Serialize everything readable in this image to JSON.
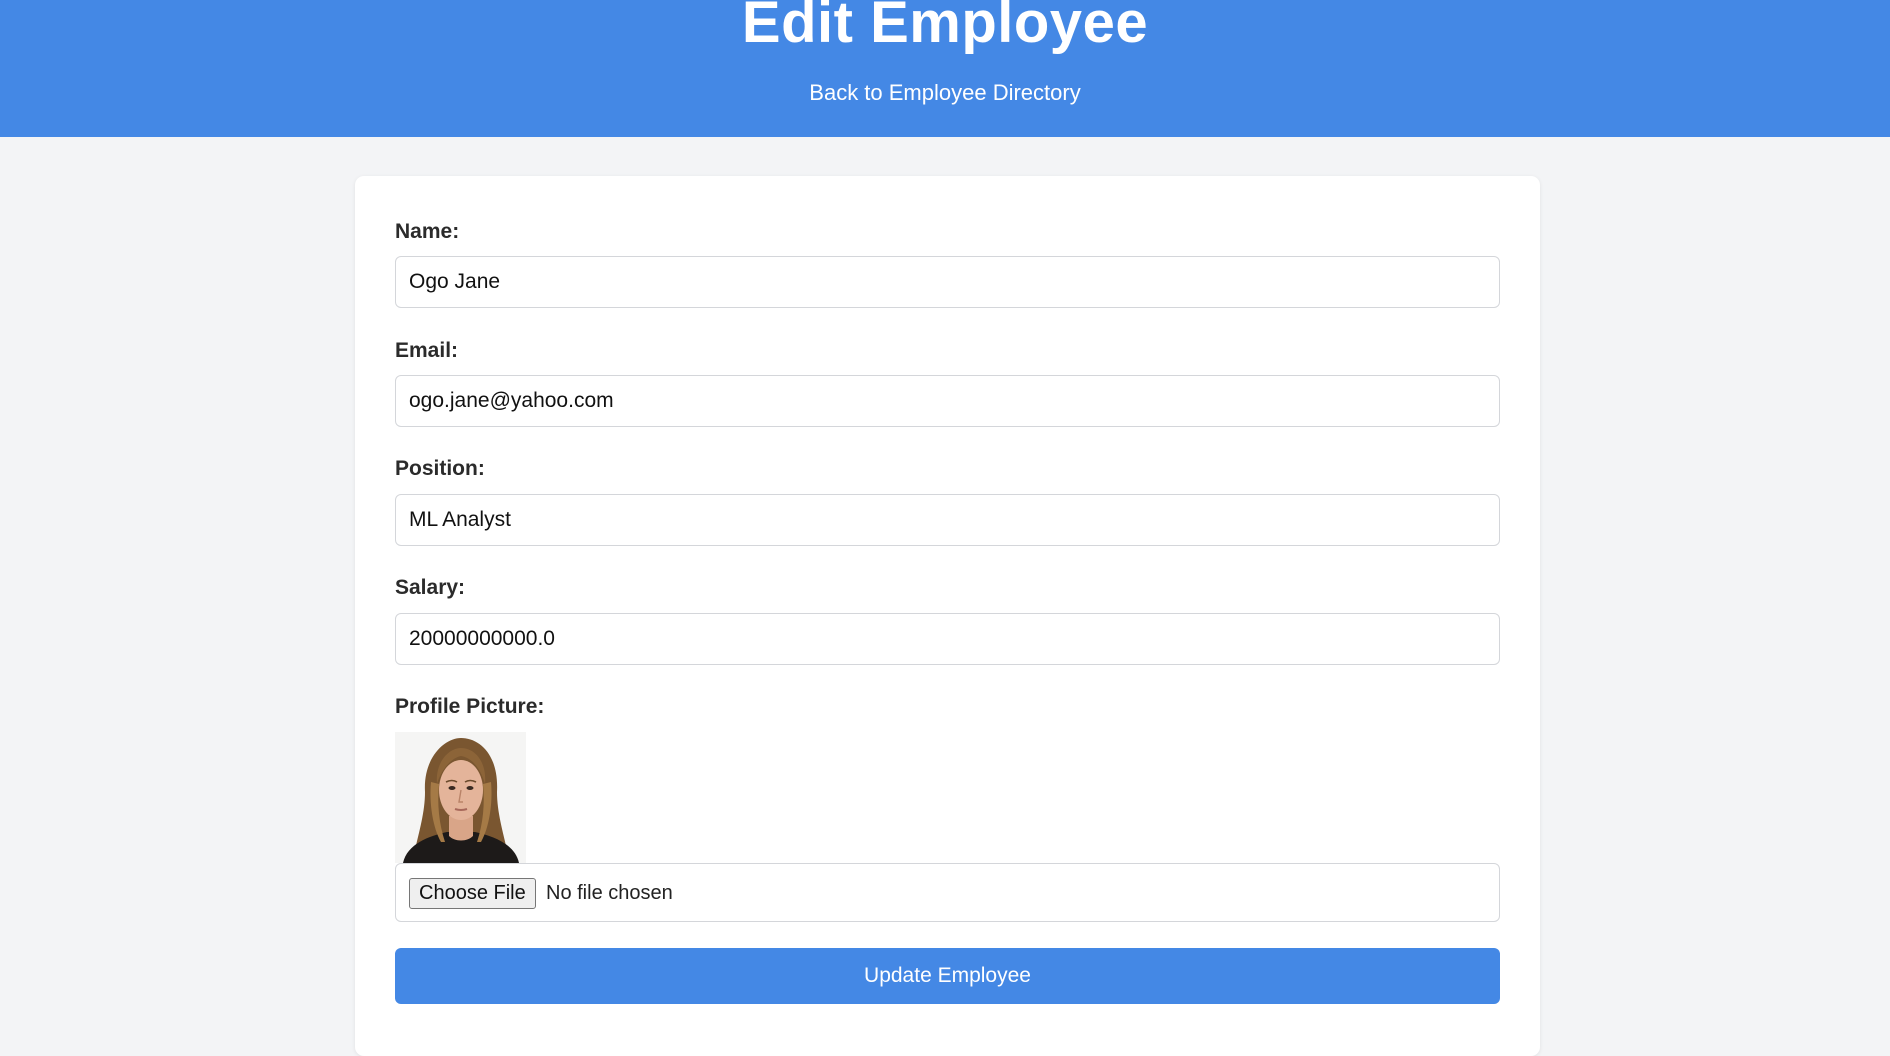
{
  "header": {
    "title": "Edit Employee",
    "back_link": "Back to Employee Directory",
    "background_color": "#4488e5"
  },
  "form": {
    "name": {
      "label": "Name:",
      "value": "Ogo Jane"
    },
    "email": {
      "label": "Email:",
      "value": "ogo.jane@yahoo.com"
    },
    "position": {
      "label": "Position:",
      "value": "ML Analyst"
    },
    "salary": {
      "label": "Salary:",
      "value": "20000000000.0"
    },
    "profile_picture": {
      "label": "Profile Picture:",
      "choose_button": "Choose File",
      "file_status": "No file chosen"
    },
    "submit_label": "Update Employee",
    "accent_color": "#4488e5"
  }
}
